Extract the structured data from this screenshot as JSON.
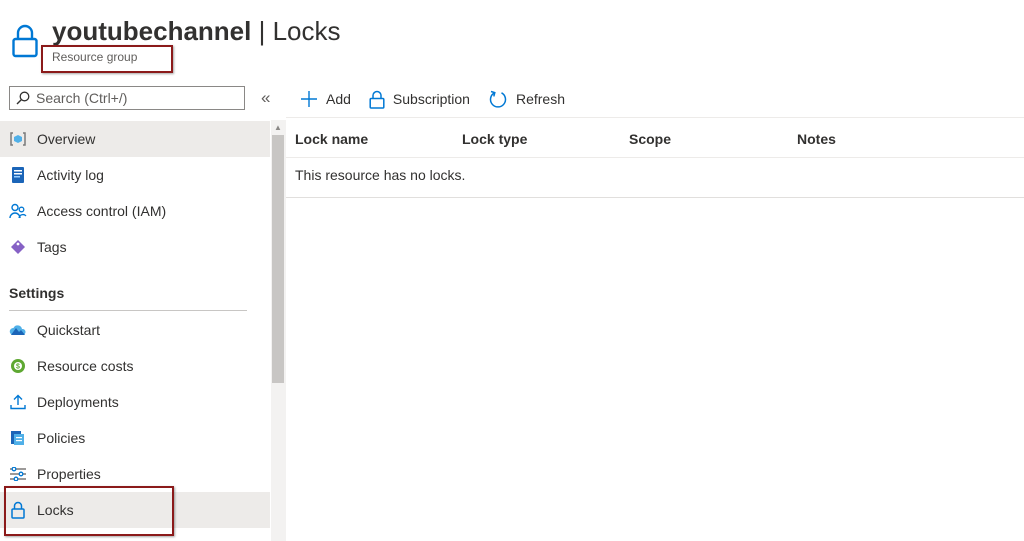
{
  "header": {
    "resource_name": "youtubechannel",
    "separator": "|",
    "page_title": "Locks",
    "resource_type": "Resource group"
  },
  "sidebar": {
    "search_placeholder": "Search (Ctrl+/)",
    "collapse_glyph": "«",
    "items": [
      {
        "label": "Overview",
        "icon": "resource-group-icon"
      },
      {
        "label": "Activity log",
        "icon": "activity-log-icon"
      },
      {
        "label": "Access control (IAM)",
        "icon": "people-icon"
      },
      {
        "label": "Tags",
        "icon": "tag-icon"
      },
      {
        "label": "Quickstart",
        "icon": "cloud-icon"
      },
      {
        "label": "Resource costs",
        "icon": "cost-icon"
      },
      {
        "label": "Deployments",
        "icon": "upload-icon"
      },
      {
        "label": "Policies",
        "icon": "policy-icon"
      },
      {
        "label": "Properties",
        "icon": "sliders-icon"
      },
      {
        "label": "Locks",
        "icon": "lock-icon"
      }
    ],
    "section_settings": "Settings"
  },
  "toolbar": {
    "add_label": "Add",
    "subscription_label": "Subscription",
    "refresh_label": "Refresh"
  },
  "table": {
    "columns": [
      "Lock name",
      "Lock type",
      "Scope",
      "Notes"
    ],
    "empty_message": "This resource has no locks."
  },
  "colors": {
    "accent": "#0078d4",
    "highlight_box": "#8b1a1a"
  }
}
